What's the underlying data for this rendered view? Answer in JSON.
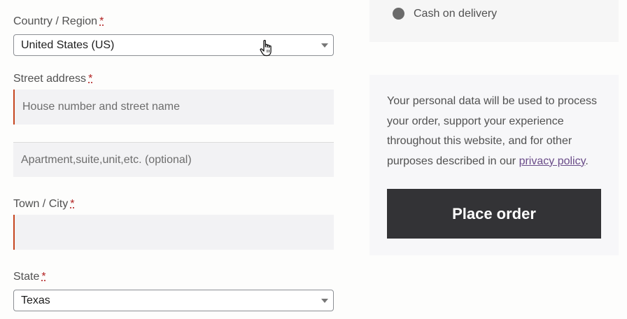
{
  "billing": {
    "country": {
      "label": "Country / Region",
      "required_mark": "*",
      "selected": "United States (US)"
    },
    "street": {
      "label": "Street address",
      "required_mark": "*",
      "line1_placeholder": "House number and street name",
      "line2_placeholder": "Apartment,suite,unit,etc. (optional)"
    },
    "city": {
      "label": "Town / City",
      "required_mark": "*",
      "value": ""
    },
    "state": {
      "label": "State",
      "required_mark": "*",
      "selected": "Texas"
    }
  },
  "payment": {
    "method_label": "Cash on delivery"
  },
  "privacy": {
    "text_before_link": "Your personal data will be used to process your order, support your experience throughout this website, and for other purposes described in our ",
    "link_text": "privacy policy",
    "text_after_link": "."
  },
  "actions": {
    "place_order_label": "Place order"
  },
  "colors": {
    "error_border": "#c6451f",
    "button_bg": "#333336",
    "link": "#6a4c89"
  }
}
